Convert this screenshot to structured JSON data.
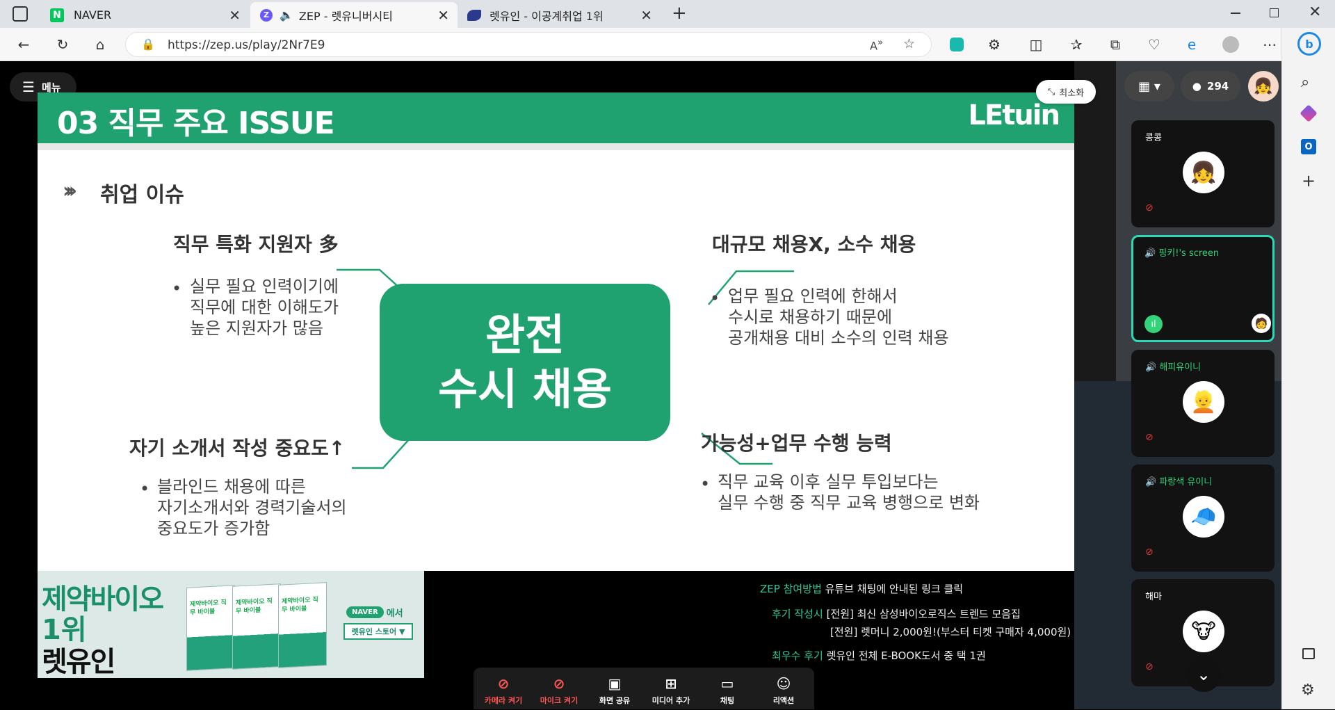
{
  "browser": {
    "tabs": [
      {
        "label": "NAVER",
        "icon": "naver-icon"
      },
      {
        "label": "ZEP - 렛유니버시티",
        "icon": "zep-icon"
      },
      {
        "label": "렛유인 - 이공계취업 1위",
        "icon": "letuin-icon"
      }
    ],
    "url": "https://zep.us/play/2Nr7E9"
  },
  "zep": {
    "menu_label": "메뉴",
    "minimize_label": "최소화",
    "user_count": "294",
    "participants": [
      {
        "name": "콩콩",
        "speaking": false
      },
      {
        "name": "핑키!'s screen",
        "speaking": true
      },
      {
        "name": "해피유이니",
        "speaking": true
      },
      {
        "name": "파랑색 유이니",
        "speaking": true
      },
      {
        "name": "해마",
        "speaking": false
      }
    ],
    "controls": [
      {
        "label": "카메라 켜기",
        "icon": "camera-off-icon",
        "muted": true
      },
      {
        "label": "마이크 켜기",
        "icon": "mic-off-icon",
        "muted": true
      },
      {
        "label": "화면 공유",
        "icon": "screen-share-icon",
        "muted": false
      },
      {
        "label": "미디어 추가",
        "icon": "add-media-icon",
        "muted": false
      },
      {
        "label": "채팅",
        "icon": "chat-icon",
        "muted": false
      },
      {
        "label": "리액션",
        "icon": "reaction-icon",
        "muted": false
      }
    ]
  },
  "slide": {
    "header_title": "03 직무 주요 ISSUE",
    "logo": "LEtuin",
    "section_title": "취업 이슈",
    "center_line1": "완전",
    "center_line2": "수시 채용",
    "q1": {
      "title": "직무 특화 지원자 多",
      "body": [
        "실무 필요 인력이기에",
        "직무에 대한 이해도가",
        "높은 지원자가 많음"
      ]
    },
    "q2": {
      "title": "대규모 채용X, 소수 채용",
      "body": [
        "업무 필요 인력에 한해서",
        "수시로 채용하기 때문에",
        "공개채용 대비 소수의 인력 채용"
      ]
    },
    "q3": {
      "title": "자기 소개서 작성 중요도↑",
      "body": [
        "블라인드 채용에 따른",
        "자기소개서와 경력기술서의",
        "중요도가 증가함"
      ]
    },
    "q4": {
      "title": "가능성+업무 수행 능력",
      "body": [
        "직무 교육 이후 실무 투입보다는",
        "실무 수행 중 직무 교육 병행으로 변화"
      ]
    }
  },
  "promo": {
    "line1": "제약바이오",
    "line2": "1위",
    "line3": "렛유인",
    "book_title": "제약바이오 직무 바이블",
    "naver_badge": "NAVER",
    "naver_suffix": "에서",
    "store_button": "렛유인 스토어 ▼"
  },
  "info": {
    "row1_label": "ZEP 참여방법",
    "row1_text": "유튜브 채팅에 안내된 링크 클릭",
    "row2_label": "후기 작성시",
    "row2_text": "[전원] 최신 삼성바이오로직스 트렌드 모음집",
    "row3_text": "[전원] 렛머니 2,000원!(부스터 티켓 구매자 4,000원)",
    "row4_label": "최우수 후기",
    "row4_text": "렛유인 전체 E-BOOK도서 중 택 1권"
  },
  "colors": {
    "accent": "#1fa270",
    "accent_dark": "#16855b",
    "muted_red": "#e03b3b",
    "speaking_green": "#34d27a"
  }
}
